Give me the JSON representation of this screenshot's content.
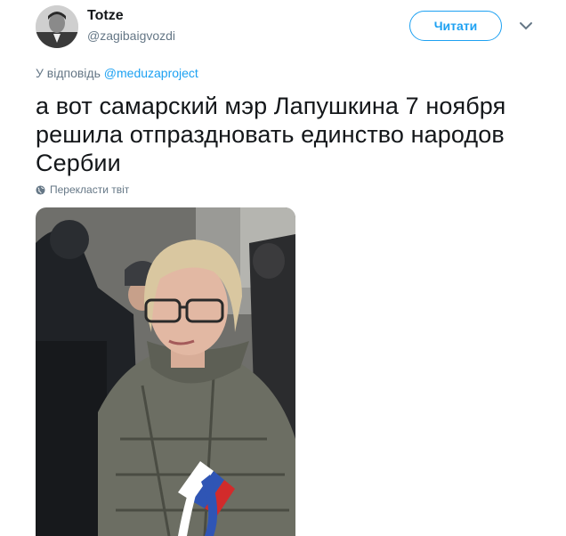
{
  "author": {
    "display_name": "Totze",
    "handle": "@zagibaigvozdi"
  },
  "follow_button": {
    "label": "Читати"
  },
  "reply": {
    "prefix": "У відповідь",
    "mention": "@meduzaproject"
  },
  "tweet": {
    "text": "а вот самарский мэр Лапушкина 7 ноября решила отпраздновать единство народов Сербии"
  },
  "translate": {
    "label": "Перекласти твіт",
    "icon": "globe-icon"
  },
  "icons": {
    "more": "chevron-down-icon"
  },
  "colors": {
    "accent": "#1da1f2",
    "text": "#14171a",
    "secondary": "#657786"
  }
}
